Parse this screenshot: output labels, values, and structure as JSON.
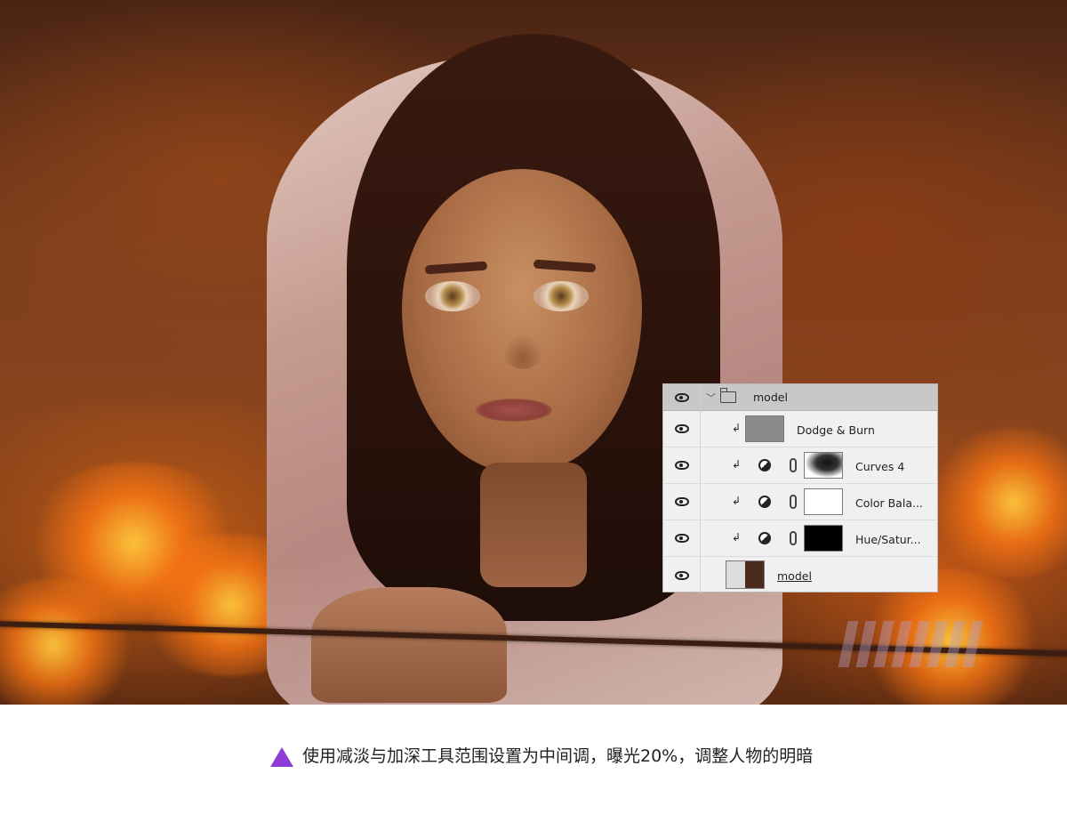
{
  "layers_panel": {
    "rows": [
      {
        "type": "group",
        "name": "model",
        "icon": "folder-icon"
      },
      {
        "type": "layer",
        "name": "Dodge & Burn",
        "clipped": true
      },
      {
        "type": "adjustment",
        "name": "Curves 4",
        "clipped": true
      },
      {
        "type": "adjustment",
        "name": "Color Bala...",
        "clipped": true
      },
      {
        "type": "adjustment",
        "name": "Hue/Satur...",
        "clipped": true
      },
      {
        "type": "smart-object",
        "name": "model"
      }
    ]
  },
  "caption": {
    "marker_color": "#8e3bd8",
    "text": "使用减淡与加深工具范围设置为中间调，曝光20%，调整人物的明暗"
  },
  "colors": {
    "panel_bg": "#f0f0f0",
    "group_row_bg": "#c8c8c8"
  }
}
